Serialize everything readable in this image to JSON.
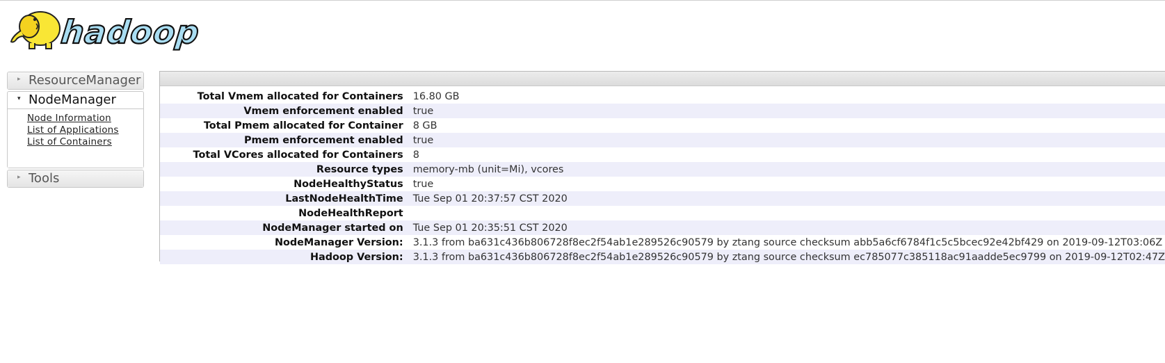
{
  "logo": {
    "text": "hadoop"
  },
  "nav": [
    {
      "label": "ResourceManager",
      "expanded": false,
      "links": []
    },
    {
      "label": "NodeManager",
      "expanded": true,
      "links": [
        "Node Information",
        "List of Applications",
        "List of Containers"
      ]
    },
    {
      "label": "Tools",
      "expanded": false,
      "links": []
    }
  ],
  "info": {
    "rows": [
      {
        "key": "Total Vmem allocated for Containers",
        "value": "16.80 GB"
      },
      {
        "key": "Vmem enforcement enabled",
        "value": "true"
      },
      {
        "key": "Total Pmem allocated for Container",
        "value": "8 GB"
      },
      {
        "key": "Pmem enforcement enabled",
        "value": "true"
      },
      {
        "key": "Total VCores allocated for Containers",
        "value": "8"
      },
      {
        "key": "Resource types",
        "value": "memory-mb (unit=Mi), vcores"
      },
      {
        "key": "NodeHealthyStatus",
        "value": "true"
      },
      {
        "key": "LastNodeHealthTime",
        "value": "Tue Sep 01 20:37:57 CST 2020"
      },
      {
        "key": "NodeHealthReport",
        "value": ""
      },
      {
        "key": "NodeManager started on",
        "value": "Tue Sep 01 20:35:51 CST 2020"
      },
      {
        "key": "NodeManager Version:",
        "value": "3.1.3 from ba631c436b806728f8ec2f54ab1e289526c90579 by ztang source checksum abb5a6cf6784f1c5c5bcec92e42bf429 on 2019-09-12T03:06Z"
      },
      {
        "key": "Hadoop Version:",
        "value": "3.1.3 from ba631c436b806728f8ec2f54ab1e289526c90579 by ztang source checksum ec785077c385118ac91aadde5ec9799 on 2019-09-12T02:47Z"
      }
    ]
  },
  "colors": {
    "row_alt": "#eeeefa",
    "logo_text": "#a9ddf2",
    "logo_elephant": "#f9e635"
  }
}
